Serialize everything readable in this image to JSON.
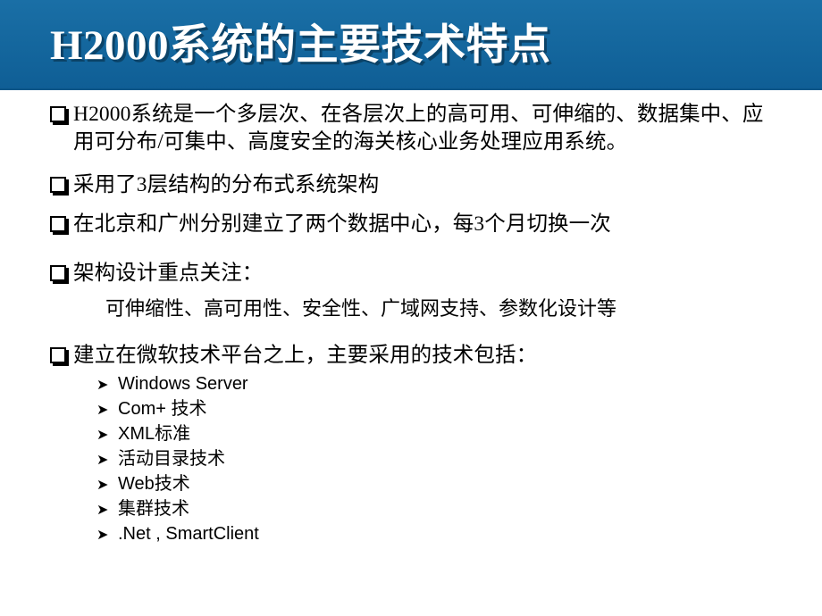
{
  "slide": {
    "title": "H2000系统的主要技术特点",
    "theme": {
      "header_blue": "#1569a0",
      "header_blue_dark": "#0f5e95",
      "title_color": "#ffffff",
      "body_bg": "#ffffff",
      "body_text": "#000000"
    },
    "bullets": [
      {
        "marker": "square-bullet",
        "text": "H2000系统是一个多层次、在各层次上的高可用、可伸缩的、数据集中、应用可分布/可集中、高度安全的海关核心业务处理应用系统。"
      },
      {
        "marker": "square-bullet",
        "text": "采用了3层结构的分布式系统架构"
      },
      {
        "marker": "square-bullet",
        "text": "在北京和广州分别建立了两个数据中心，每3个月切换一次"
      },
      {
        "marker": "square-bullet",
        "text": "架构设计重点关注："
      },
      {
        "marker": "none",
        "text": "可伸缩性、高可用性、安全性、广域网支持、参数化设计等"
      },
      {
        "marker": "square-bullet",
        "text": "建立在微软技术平台之上，主要采用的技术包括："
      }
    ],
    "sub_items": [
      {
        "marker": "arrow-bullet",
        "label": "Windows Server"
      },
      {
        "marker": "arrow-bullet",
        "label": "Com+ 技术"
      },
      {
        "marker": "arrow-bullet",
        "label": "XML标准"
      },
      {
        "marker": "arrow-bullet",
        "label": "活动目录技术"
      },
      {
        "marker": "arrow-bullet",
        "label": "Web技术"
      },
      {
        "marker": "arrow-bullet",
        "label": "集群技术"
      },
      {
        "marker": "arrow-bullet",
        "label": ".Net , SmartClient"
      }
    ],
    "markers": {
      "square": "❑",
      "arrow": "➢"
    }
  }
}
